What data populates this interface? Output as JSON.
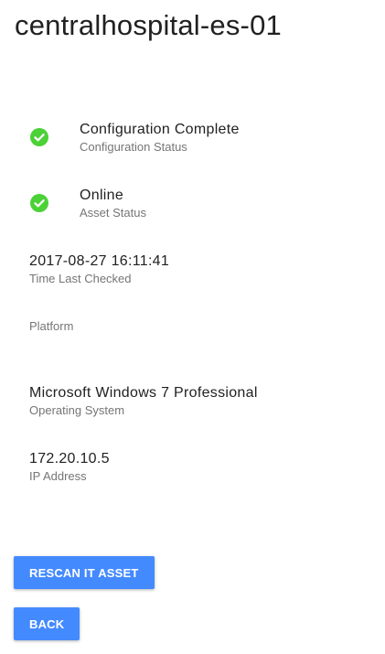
{
  "page": {
    "title": "centralhospital-es-01"
  },
  "fields": {
    "configuration": {
      "value": "Configuration Complete",
      "label": "Configuration Status",
      "icon": "check-circle-icon",
      "color": "#4cd137"
    },
    "asset": {
      "value": "Online",
      "label": "Asset Status",
      "icon": "check-circle-icon",
      "color": "#4cd137"
    },
    "last_checked": {
      "value": "2017-08-27 16:11:41",
      "label": "Time Last Checked"
    },
    "platform": {
      "value": "",
      "label": "Platform"
    },
    "os": {
      "value": "Microsoft Windows 7 Professional",
      "label": "Operating System"
    },
    "ip": {
      "value": "172.20.10.5",
      "label": "IP Address"
    }
  },
  "actions": {
    "rescan_label": "RESCAN IT ASSET",
    "back_label": "BACK",
    "button_color": "#448aff"
  }
}
